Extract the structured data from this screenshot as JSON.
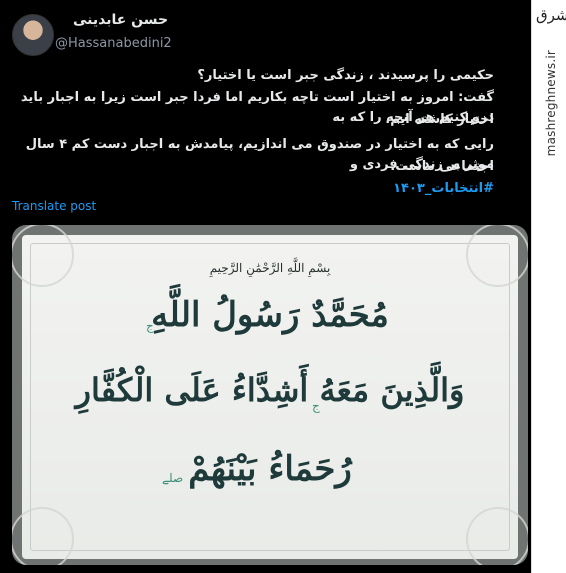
{
  "watermark": {
    "logo_text": "مشرق",
    "site": "mashreghnews.ir"
  },
  "author": {
    "name": "حسن عابدینی",
    "handle": "@Hassanabedini2"
  },
  "tweet": {
    "lines": [
      "حکیمی را پرسیدند ، زندگی جبر است یا اختیار؟",
      "گفت: امروز به اختیار است تاچه بکاریم اما فردا جبر است زیرا به اجبار باید درو کنیم هر آنچه را که به",
      "اختیار کاشته ایم.",
      "رایی که به اختیار در صندوق می اندازیم، پیامدش به اجبار دست کم ۴ سال موثر بر زندگی فردی و",
      "اجتماعی ماست.",
      "#انتخابات_۱۴۰۳"
    ]
  },
  "translate_label": "Translate post",
  "media": {
    "basmala": "بِسْمِ اللَّهِ الرَّحْمَٰنِ الرَّحِيمِ",
    "verse_lines": [
      "مُحَمَّدٌ رَسُولُ اللَّهِ",
      "وَالَّذِينَ مَعَهُ أَشِدَّاءُ عَلَى الْكُفَّارِ",
      "رُحَمَاءُ بَيْنَهُمْ"
    ],
    "mark_1": "ج",
    "mark_2": "ج",
    "mark_3": "صلے"
  },
  "colors": {
    "background": "#000000",
    "link": "#1d9bf0",
    "text": "#e7e9ea",
    "muted": "#8b98a5"
  }
}
